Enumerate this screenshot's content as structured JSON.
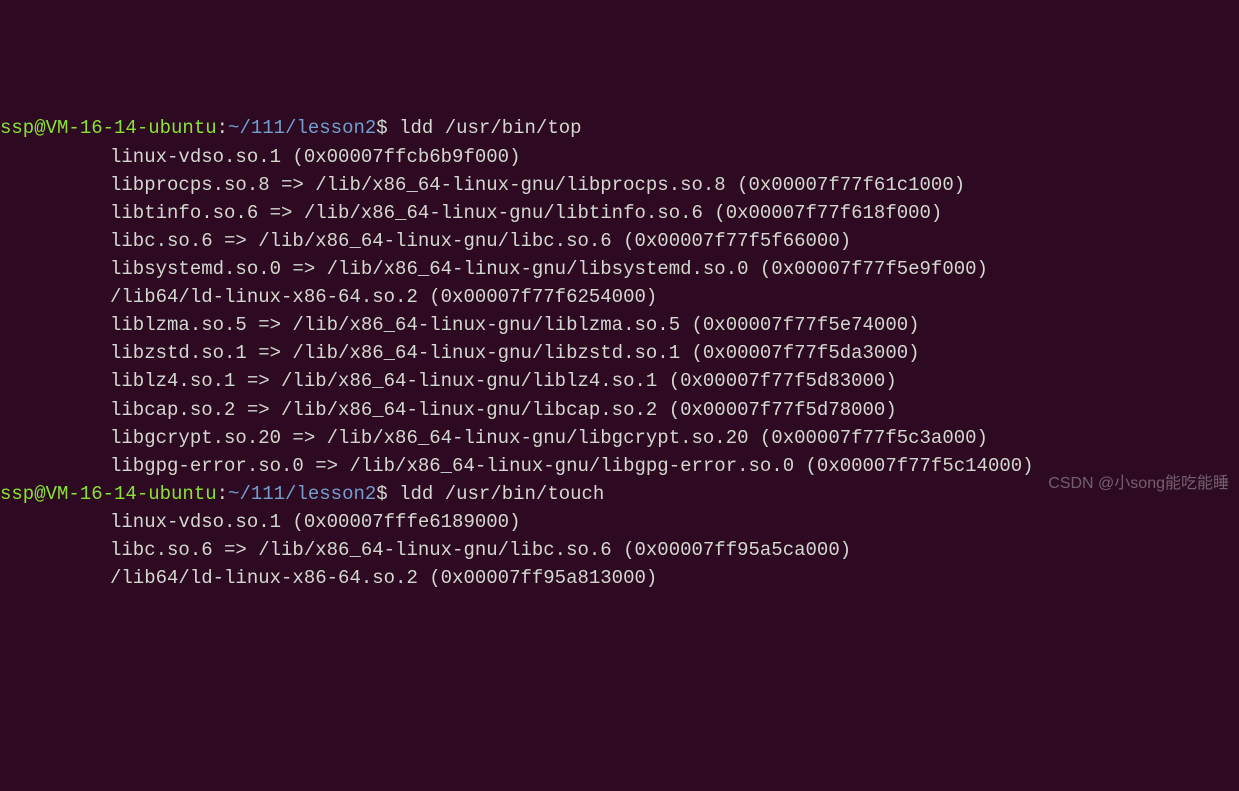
{
  "terminal": {
    "prompt1": {
      "userhost": "ssp@VM-16-14-ubuntu",
      "sep1": ":",
      "path": "~/111/lesson2",
      "sep2": "$ ",
      "command": "ldd /usr/bin/top"
    },
    "output1": [
      "linux-vdso.so.1 (0x00007ffcb6b9f000)",
      "libprocps.so.8 => /lib/x86_64-linux-gnu/libprocps.so.8 (0x00007f77f61c1000)",
      "libtinfo.so.6 => /lib/x86_64-linux-gnu/libtinfo.so.6 (0x00007f77f618f000)",
      "libc.so.6 => /lib/x86_64-linux-gnu/libc.so.6 (0x00007f77f5f66000)",
      "libsystemd.so.0 => /lib/x86_64-linux-gnu/libsystemd.so.0 (0x00007f77f5e9f000)",
      "/lib64/ld-linux-x86-64.so.2 (0x00007f77f6254000)",
      "liblzma.so.5 => /lib/x86_64-linux-gnu/liblzma.so.5 (0x00007f77f5e74000)",
      "libzstd.so.1 => /lib/x86_64-linux-gnu/libzstd.so.1 (0x00007f77f5da3000)",
      "liblz4.so.1 => /lib/x86_64-linux-gnu/liblz4.so.1 (0x00007f77f5d83000)",
      "libcap.so.2 => /lib/x86_64-linux-gnu/libcap.so.2 (0x00007f77f5d78000)",
      "libgcrypt.so.20 => /lib/x86_64-linux-gnu/libgcrypt.so.20 (0x00007f77f5c3a000)",
      "libgpg-error.so.0 => /lib/x86_64-linux-gnu/libgpg-error.so.0 (0x00007f77f5c14000)"
    ],
    "prompt2": {
      "userhost": "ssp@VM-16-14-ubuntu",
      "sep1": ":",
      "path": "~/111/lesson2",
      "sep2": "$ ",
      "command": "ldd /usr/bin/touch"
    },
    "output2": [
      "linux-vdso.so.1 (0x00007fffe6189000)",
      "libc.so.6 => /lib/x86_64-linux-gnu/libc.so.6 (0x00007ff95a5ca000)",
      "/lib64/ld-linux-x86-64.so.2 (0x00007ff95a813000)"
    ]
  },
  "watermark": "CSDN @小song能吃能睡"
}
